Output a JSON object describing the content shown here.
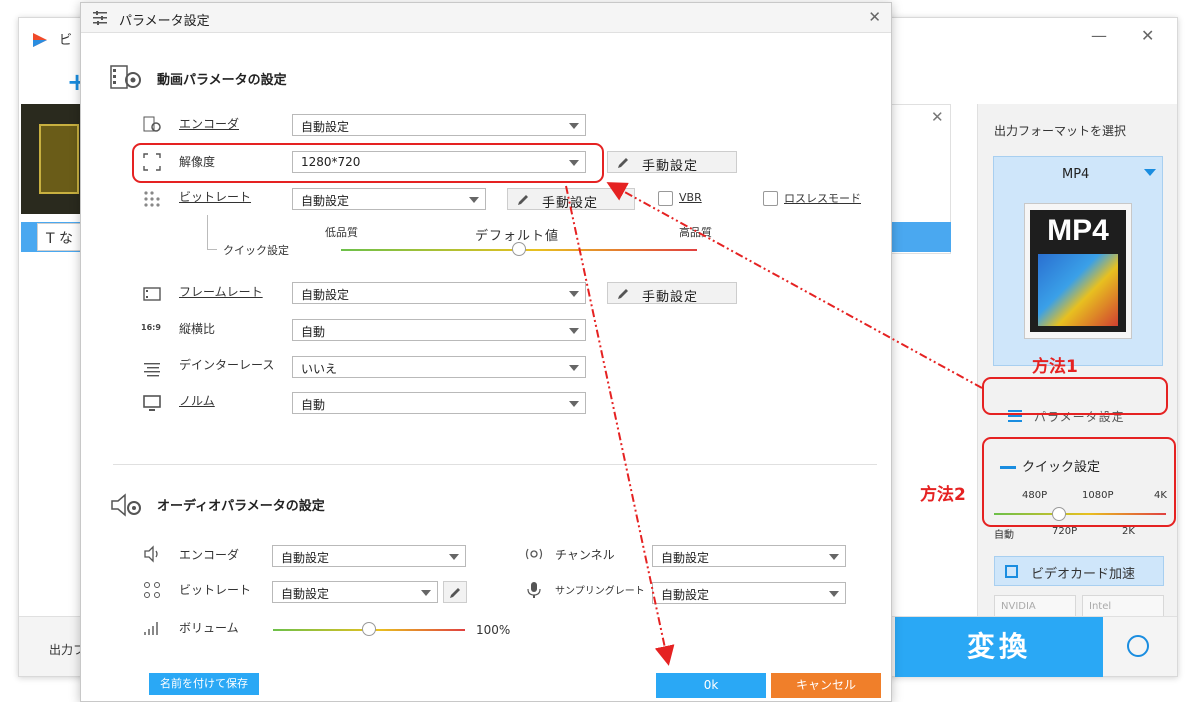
{
  "app": {
    "title_fragment": "ビ"
  },
  "background": {
    "subtitle_prefix": "T な",
    "right_panel": {
      "output_label": "出力フォーマットを選択",
      "format": "MP4",
      "format_icon_text": "MP4",
      "param_button": "パラメータ設定",
      "quick_title": "クイック設定",
      "quick_top_ticks": [
        "480P",
        "1080P",
        "4K"
      ],
      "quick_bottom_ticks": [
        "自動",
        "720P",
        "2K"
      ],
      "quick_value": 0.38,
      "gpu_button": "ビデオカード加速",
      "gpu_vendors": [
        "NVIDIA",
        "Intel"
      ]
    },
    "bottom": {
      "output_label_fragment": "出力フ",
      "convert_label": "変換"
    }
  },
  "dialog": {
    "title": "パラメータ設定",
    "video": {
      "section_title": "動画パラメータの設定",
      "encoder": {
        "label": "エンコーダ",
        "value": "自動設定"
      },
      "resolution": {
        "label": "解像度",
        "value": "1280*720",
        "manual": "手動設定"
      },
      "bitrate": {
        "label": "ビットレート",
        "value": "自動設定",
        "manual": "手動設定",
        "vbr": "VBR",
        "lossless": "ロスレスモード"
      },
      "quick": {
        "label": "クイック設定",
        "low": "低品質",
        "default": "デフォルト値",
        "high": "高品質",
        "value": 0.5
      },
      "framerate": {
        "label": "フレームレート",
        "value": "自動設定",
        "manual": "手動設定"
      },
      "aspect": {
        "label": "縦横比",
        "value": "自動",
        "icon_text": "16:9"
      },
      "deinterlace": {
        "label": "デインターレース",
        "value": "いいえ"
      },
      "norm": {
        "label": "ノルム",
        "value": "自動"
      }
    },
    "audio": {
      "section_title": "オーディオパラメータの設定",
      "encoder": {
        "label": "エンコーダ",
        "value": "自動設定"
      },
      "bitrate": {
        "label": "ビットレート",
        "value": "自動設定"
      },
      "channel": {
        "label": "チャンネル",
        "value": "自動設定"
      },
      "samplerate": {
        "label": "サンプリングレート",
        "value": "自動設定"
      },
      "volume": {
        "label": "ボリューム",
        "value_text": "100%",
        "value": 0.5
      }
    },
    "buttons": {
      "save": "名前を付けて保存",
      "ok": "0k",
      "cancel": "キャンセル"
    }
  },
  "annotations": {
    "method1": "方法1",
    "method2": "方法2"
  },
  "colors": {
    "accent": "#2aa8f5",
    "annotation": "#e52222",
    "cancel": "#f07f2a"
  }
}
